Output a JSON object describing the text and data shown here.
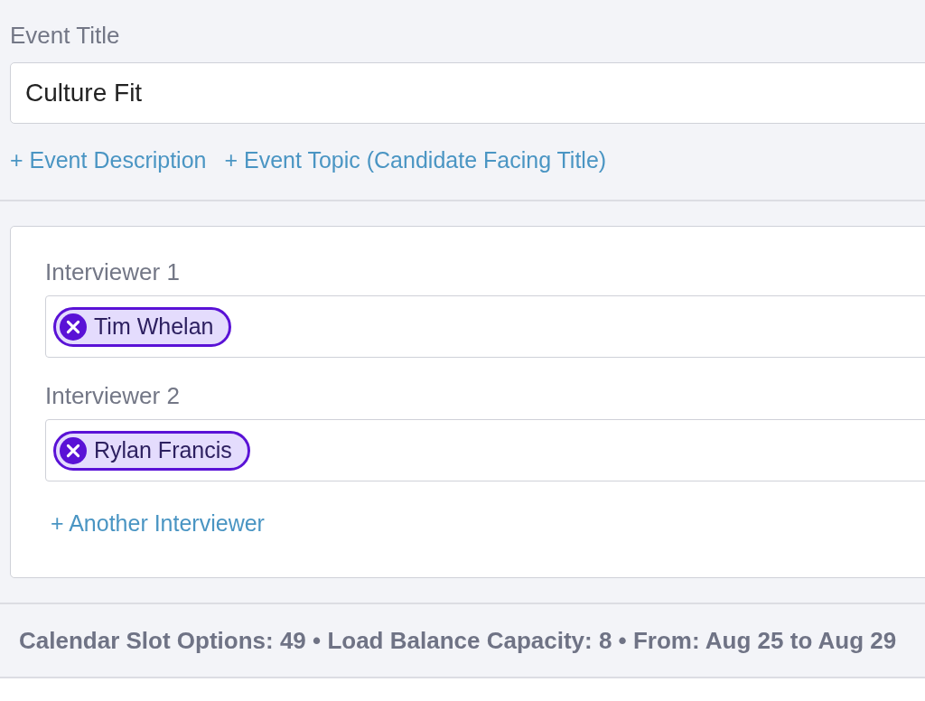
{
  "event_title": {
    "label": "Event Title",
    "value": "Culture Fit"
  },
  "links": [
    "+ Event Description",
    "+ Event Topic (Candidate Facing Title)"
  ],
  "interviewers": [
    {
      "label": "Interviewer 1",
      "chips": [
        "Tim Whelan"
      ]
    },
    {
      "label": "Interviewer 2",
      "chips": [
        "Rylan Francis"
      ]
    }
  ],
  "add_interviewer": "+ Another Interviewer",
  "summary": "Calendar Slot Options: 49 • Load Balance Capacity: 8 • From: Aug 25 to Aug 29"
}
